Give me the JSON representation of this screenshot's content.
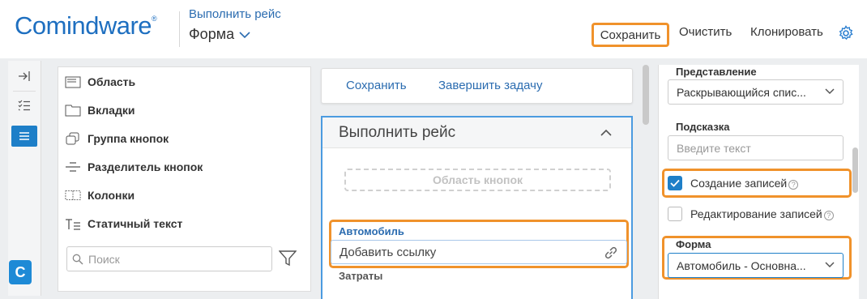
{
  "header": {
    "logo": "Comindware",
    "logo_mark": "®",
    "breadcrumb_link": "Выполнить рейс",
    "page_title": "Форма",
    "buttons": {
      "save": "Сохранить",
      "clear": "Очистить",
      "clone": "Клонировать"
    }
  },
  "rail": {
    "brand": "C"
  },
  "palette": {
    "items": [
      {
        "label": "Область",
        "icon": "area-icon"
      },
      {
        "label": "Вкладки",
        "icon": "tabs-icon"
      },
      {
        "label": "Группа кнопок",
        "icon": "button-group-icon"
      },
      {
        "label": "Разделитель кнопок",
        "icon": "button-separator-icon"
      },
      {
        "label": "Колонки",
        "icon": "columns-icon"
      },
      {
        "label": "Статичный текст",
        "icon": "static-text-icon"
      }
    ],
    "search_placeholder": "Поиск"
  },
  "canvas": {
    "toolbar": {
      "save": "Сохранить",
      "complete": "Завершить задачу"
    },
    "form_title": "Выполнить рейс",
    "button_area": "Область кнопок",
    "field": {
      "label": "Автомобиль",
      "placeholder": "Добавить ссылку"
    },
    "next_field_label": "Затраты"
  },
  "properties": {
    "representation_label": "Представление",
    "representation_value": "Раскрывающийся спис...",
    "hint_label": "Подсказка",
    "hint_placeholder": "Введите текст",
    "create_records": {
      "label": "Создание записей",
      "checked": true
    },
    "edit_records": {
      "label": "Редактирование записей",
      "checked": false
    },
    "form_label": "Форма",
    "form_value": "Автомобиль - Основна..."
  },
  "colors": {
    "accent": "#1e7fc8",
    "highlight": "#f0922b",
    "link": "#2b6cb0"
  }
}
